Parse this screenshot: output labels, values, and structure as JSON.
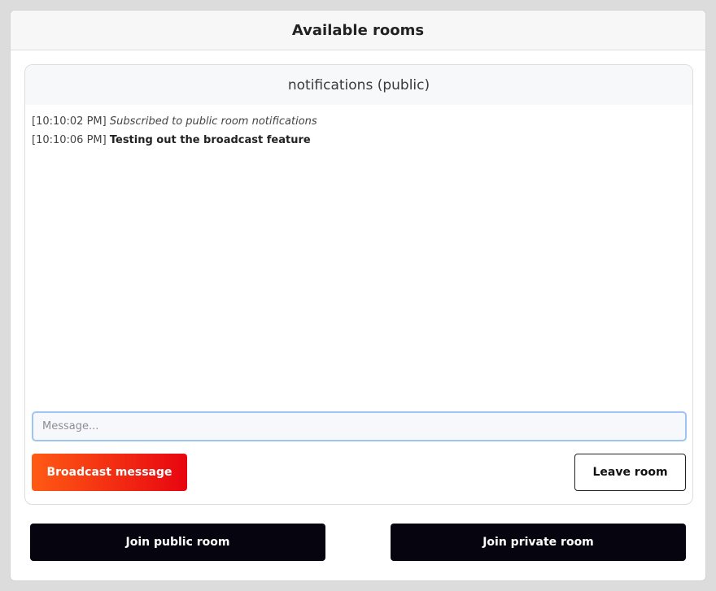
{
  "header": {
    "title": "Available rooms"
  },
  "room": {
    "title": "notifications (public)",
    "messages": [
      {
        "time": "[10:10:02 PM]",
        "text": "Subscribed to public room notifications"
      },
      {
        "time": "[10:10:06 PM]",
        "text": "Testing out the broadcast feature"
      }
    ],
    "input": {
      "placeholder": "Message...",
      "value": ""
    },
    "broadcast_label": "Broadcast message",
    "leave_label": "Leave room"
  },
  "actions": {
    "join_public_label": "Join public room",
    "join_private_label": "Join private room"
  }
}
